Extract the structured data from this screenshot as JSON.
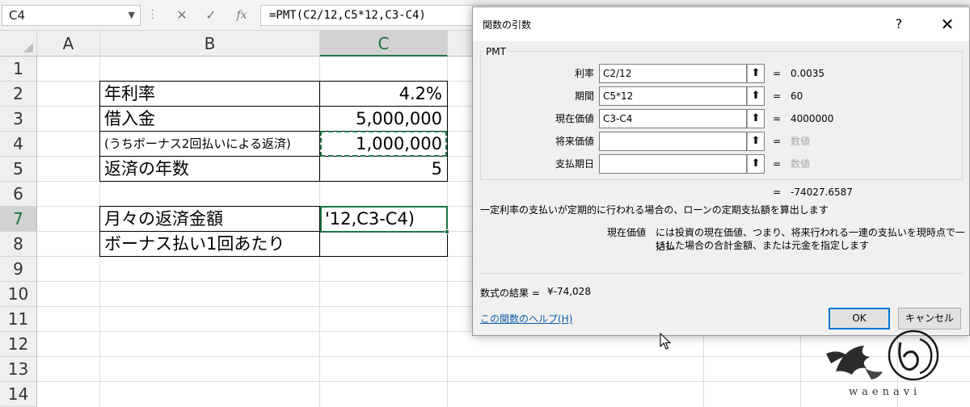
{
  "formula_bar": {
    "name_box": "C4",
    "dots": "⋮",
    "cancel_icon": "✕",
    "enter_icon": "✓",
    "fx_label": "fx",
    "formula": "=PMT(C2/12,C5*12,C3-C4)"
  },
  "columns": [
    "A",
    "B",
    "C"
  ],
  "rows": [
    "1",
    "2",
    "3",
    "4",
    "5",
    "6",
    "7",
    "8",
    "9",
    "10",
    "11",
    "12",
    "13",
    "14"
  ],
  "cells": {
    "b2": "年利率",
    "c2": "4.2%",
    "b3": "借入金",
    "c3": "5,000,000",
    "b4": "(うちボーナス2回払いによる返済)",
    "c4": "1,000,000",
    "b5": "返済の年数",
    "c5": "5",
    "b7": "月々の返済金額",
    "c7": "'12,C3-C4)",
    "b8": "ボーナス払い1回あたり"
  },
  "dialog": {
    "title": "関数の引数",
    "help_button": "?",
    "close_button": "✕",
    "function_name": "PMT",
    "args": [
      {
        "label": "利率",
        "value": "C2/12",
        "result": "0.0035",
        "dim": false
      },
      {
        "label": "期間",
        "value": "C5*12",
        "result": "60",
        "dim": false
      },
      {
        "label": "現在価値",
        "value": "C3-C4",
        "result": "4000000",
        "dim": false
      },
      {
        "label": "将来価値",
        "value": "",
        "result": "数値",
        "dim": true
      },
      {
        "label": "支払期日",
        "value": "",
        "result": "数値",
        "dim": true
      }
    ],
    "ref_button": "⬆",
    "equals": "=",
    "overall_result": "-74027.6587",
    "description": "一定利率の支払いが定期的に行われる場合の、ローンの定期支払額を算出します",
    "arg_help_name": "現在価値",
    "arg_help_line1": "には投資の現在価値、つまり、将来行われる一連の支払いを現時点で一括払",
    "arg_help_line2": "いした場合の合計金額、または元金を指定します",
    "formula_result_label": "数式の結果 =",
    "formula_result_value": "¥-74,028",
    "help_link": "この関数のヘルプ(H)",
    "ok_button": "OK",
    "cancel_button": "キャンセル"
  },
  "watermark": "waenavi",
  "colors": {
    "excel_green": "#217346",
    "ok_border": "#0078d7",
    "link": "#0b5cad"
  }
}
